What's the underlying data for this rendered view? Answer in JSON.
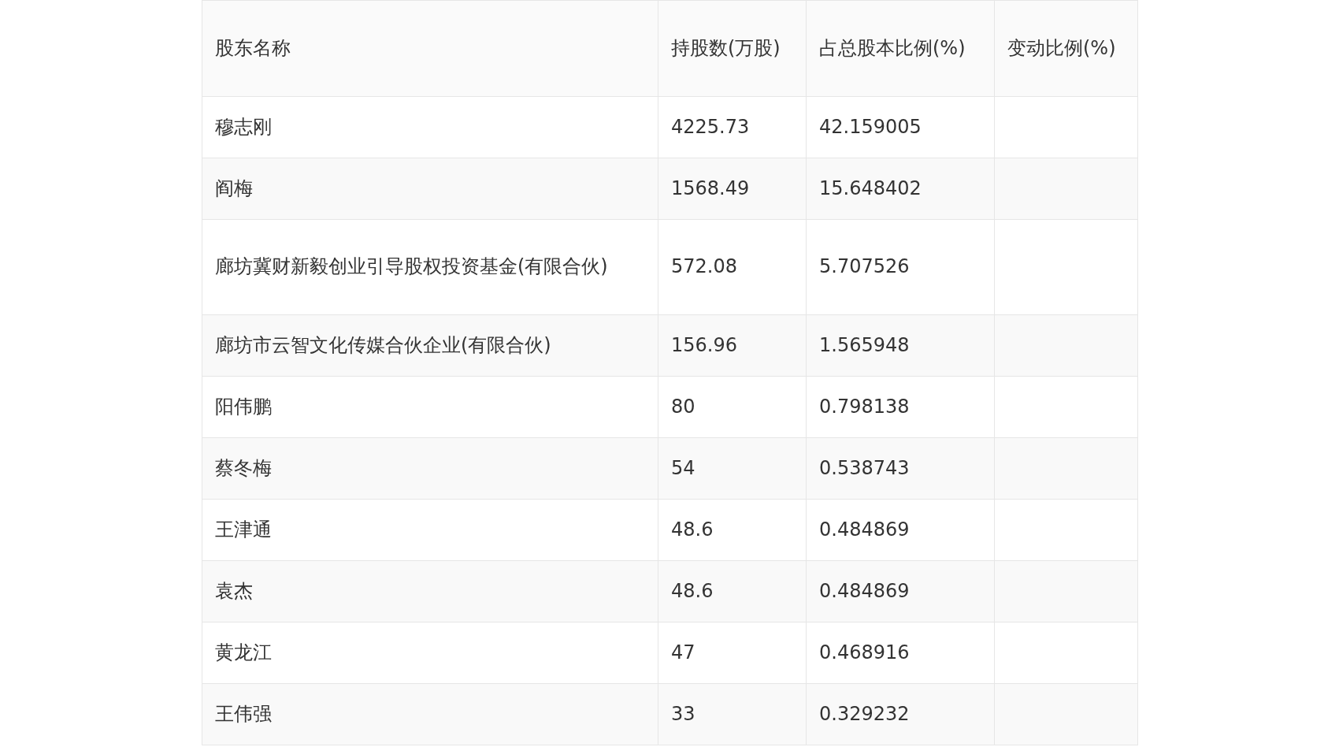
{
  "table": {
    "columns": [
      "股东名称",
      "持股数(万股)",
      "占总股本比例(%)",
      "变动比例(%)"
    ],
    "rows": [
      {
        "name": "穆志刚",
        "shares": "4225.73",
        "ratio": "42.159005"
      },
      {
        "name": "阎梅",
        "shares": "1568.49",
        "ratio": "15.648402"
      },
      {
        "name": "廊坊冀财新毅创业引导股权投资基金(有限合伙)",
        "shares": "572.08",
        "ratio": "5.707526"
      },
      {
        "name": "廊坊市云智文化传媒合伙企业(有限合伙)",
        "shares": "156.96",
        "ratio": "1.565948"
      },
      {
        "name": "阳伟鹏",
        "shares": "80",
        "ratio": "0.798138"
      },
      {
        "name": "蔡冬梅",
        "shares": "54",
        "ratio": "0.538743"
      },
      {
        "name": "王津通",
        "shares": "48.6",
        "ratio": "0.484869"
      },
      {
        "name": "袁杰",
        "shares": "48.6",
        "ratio": "0.484869"
      },
      {
        "name": "黄龙江",
        "shares": "47",
        "ratio": "0.468916"
      },
      {
        "name": "王伟强",
        "shares": "33",
        "ratio": "0.329232"
      }
    ]
  }
}
